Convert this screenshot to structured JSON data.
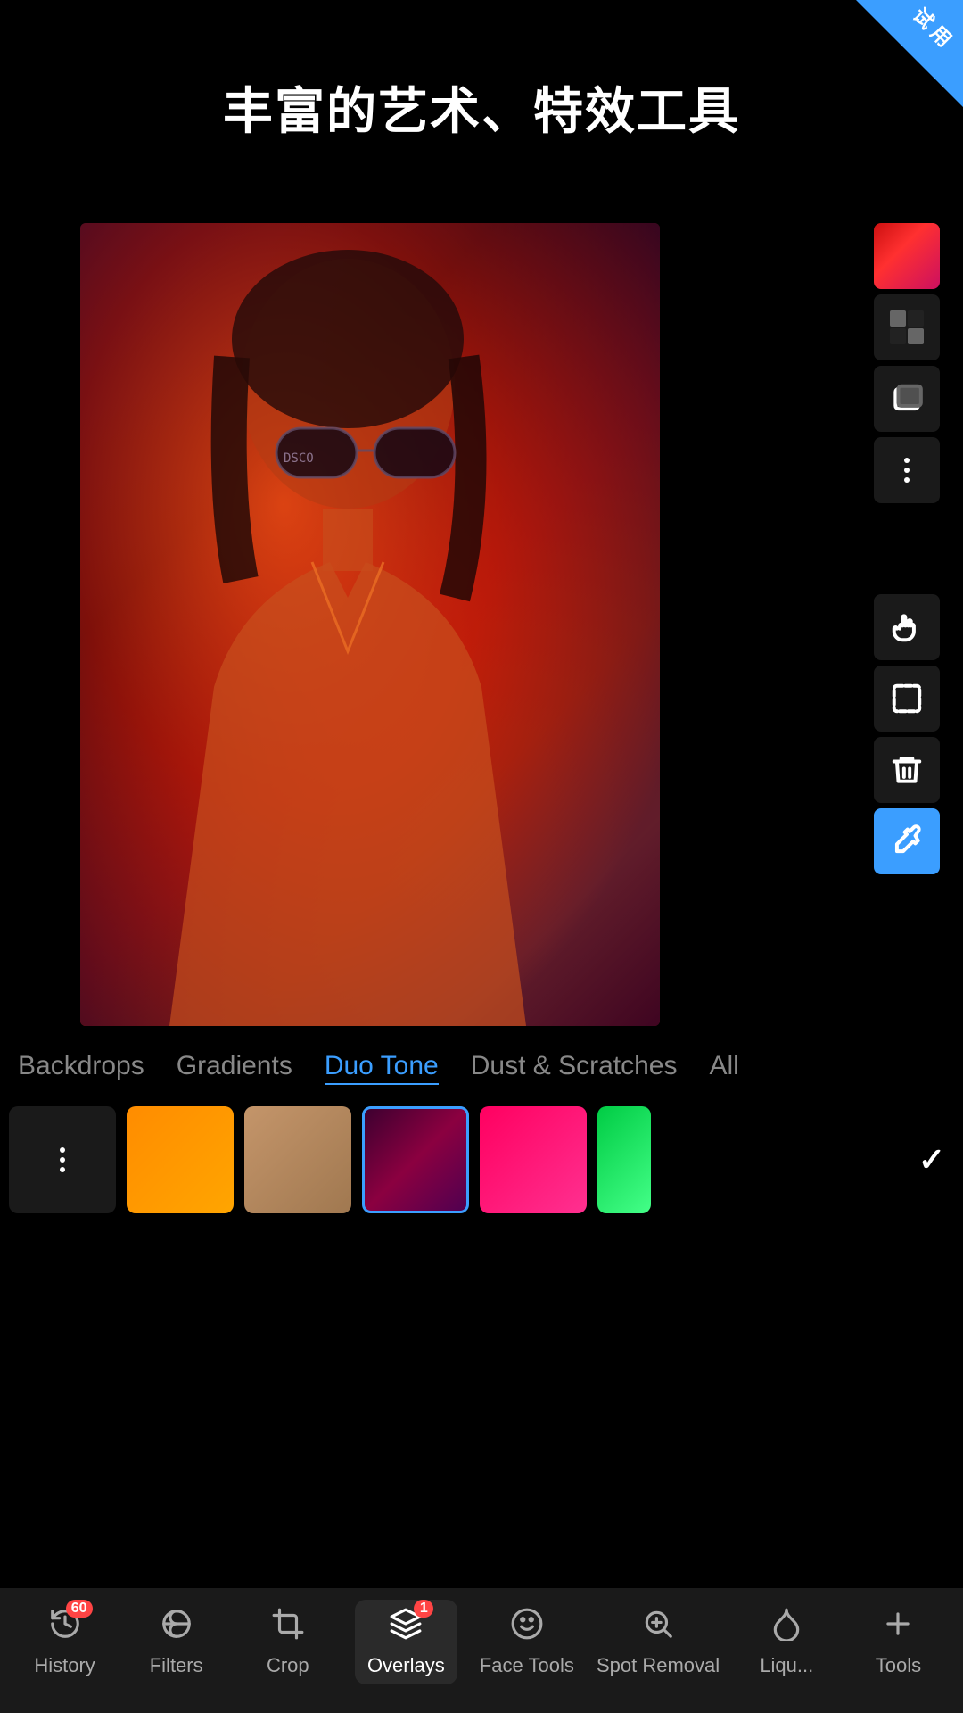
{
  "app": {
    "title": "丰富的艺术、特效工具",
    "corner_badge": "试\n用"
  },
  "categories": {
    "items": [
      {
        "id": "backdrops",
        "label": "Backdrops",
        "active": false
      },
      {
        "id": "gradients",
        "label": "Gradients",
        "active": false
      },
      {
        "id": "duotone",
        "label": "Duo Tone",
        "active": true
      },
      {
        "id": "dust",
        "label": "Dust & Scratches",
        "active": false
      },
      {
        "id": "all",
        "label": "All",
        "active": false
      }
    ]
  },
  "toolbar": {
    "tools": [
      {
        "id": "color-swatch",
        "type": "swatch",
        "label": "Color Swatch"
      },
      {
        "id": "checker",
        "type": "checker",
        "label": "Checker"
      },
      {
        "id": "layers",
        "type": "layers",
        "label": "Layers"
      },
      {
        "id": "more",
        "type": "dots",
        "label": "More Options"
      },
      {
        "id": "hand",
        "type": "hand",
        "label": "Move"
      },
      {
        "id": "selection",
        "type": "selection",
        "label": "Selection"
      },
      {
        "id": "delete",
        "type": "delete",
        "label": "Delete"
      },
      {
        "id": "eyedropper",
        "type": "eyedropper",
        "label": "Eyedropper",
        "accent": true
      }
    ]
  },
  "swatches": [
    {
      "id": "options",
      "type": "dots"
    },
    {
      "id": "orange",
      "type": "orange"
    },
    {
      "id": "tan",
      "type": "tan"
    },
    {
      "id": "dark-red",
      "type": "dark-red",
      "selected": true
    },
    {
      "id": "hot-pink",
      "type": "hot-pink"
    },
    {
      "id": "green",
      "type": "green-partial"
    }
  ],
  "bottom_nav": {
    "items": [
      {
        "id": "history",
        "label": "History",
        "icon": "history",
        "badge": "60"
      },
      {
        "id": "filters",
        "label": "Filters",
        "icon": "filters"
      },
      {
        "id": "crop",
        "label": "Crop",
        "icon": "crop"
      },
      {
        "id": "overlays",
        "label": "Overlays",
        "icon": "overlays",
        "active": true,
        "badge2": "1"
      },
      {
        "id": "facetools",
        "label": "Face Tools",
        "icon": "face"
      },
      {
        "id": "spotremoval",
        "label": "Spot Removal",
        "icon": "spot"
      },
      {
        "id": "liquify",
        "label": "Liqu...",
        "icon": "liquify"
      },
      {
        "id": "tools",
        "label": "Tools",
        "icon": "tools"
      }
    ]
  },
  "colors": {
    "accent": "#3B9EFF",
    "active_text": "#3B9EFF",
    "toolbar_bg": "#1a1a1a",
    "btn_bg": "#1a1a1a"
  }
}
